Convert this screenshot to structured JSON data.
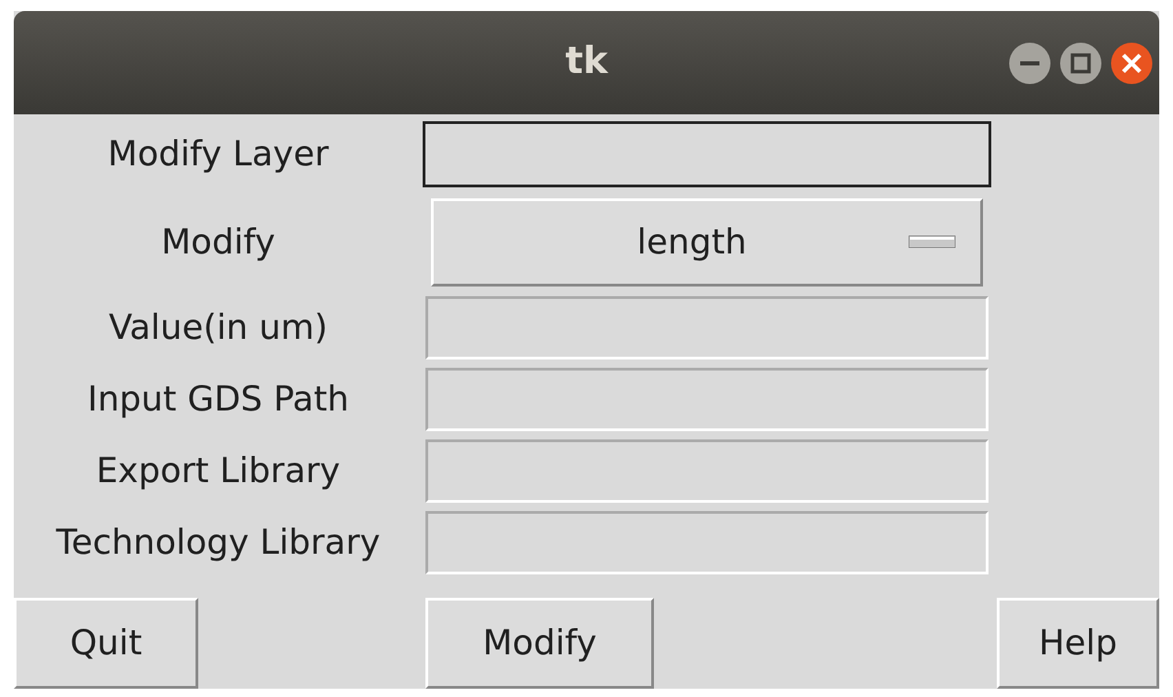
{
  "window": {
    "title": "tk"
  },
  "fields": [
    {
      "label": "Modify Layer",
      "kind": "entry",
      "focused": true
    },
    {
      "label": "Modify",
      "kind": "menubutton",
      "value": "length"
    },
    {
      "label": "Value(in um)",
      "kind": "entry",
      "focused": false
    },
    {
      "label": "Input GDS Path",
      "kind": "entry",
      "focused": false
    },
    {
      "label": "Export Library",
      "kind": "entry",
      "focused": false
    },
    {
      "label": "Technology Library",
      "kind": "entry",
      "focused": false
    }
  ],
  "buttons": [
    "Quit",
    "Modify",
    "Help"
  ]
}
